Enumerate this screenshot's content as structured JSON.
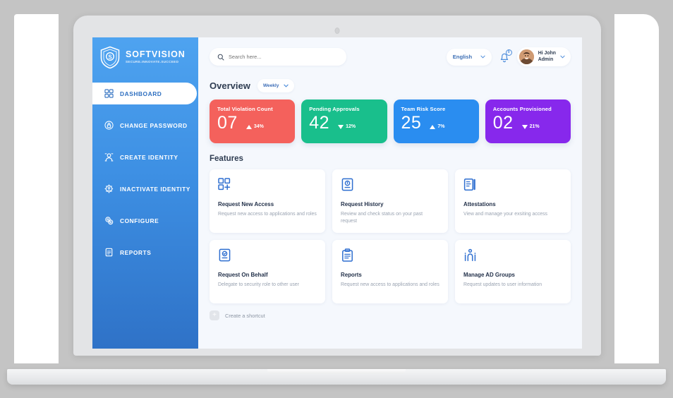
{
  "brand": {
    "name": "SOFTVISION",
    "tagline": "SECURE.INNOVATE.SUCCEED",
    "logo_icon": "shield-s-logo-icon"
  },
  "sidebar": {
    "items": [
      {
        "label": "DASHBOARD",
        "icon": "grid-icon",
        "active": true
      },
      {
        "label": "CHANGE PASSWORD",
        "icon": "lock-circle-icon",
        "active": false
      },
      {
        "label": "CREATE IDENTITY",
        "icon": "user-add-icon",
        "active": false
      },
      {
        "label": "INACTIVATE IDENTITY",
        "icon": "user-gear-icon",
        "active": false
      },
      {
        "label": "CONFIGURE",
        "icon": "gears-icon",
        "active": false
      },
      {
        "label": "REPORTS",
        "icon": "document-icon",
        "active": false
      }
    ]
  },
  "topbar": {
    "search": {
      "placeholder": "Search here...",
      "value": "",
      "icon": "search-icon"
    },
    "language": {
      "selected": "English",
      "icon": "chevron-down-icon"
    },
    "notifications": {
      "count": "0",
      "icon": "bell-icon"
    },
    "user": {
      "greeting": "Hi John",
      "role": "Admin",
      "avatar": "user-avatar",
      "icon": "chevron-down-icon"
    }
  },
  "overview": {
    "title": "Overview",
    "period": {
      "label": "Weekly",
      "icon": "chevron-down-icon"
    },
    "cards": [
      {
        "label": "Total Violation Count",
        "value": "07",
        "delta": "34%",
        "direction": "up",
        "color": "#f4615c"
      },
      {
        "label": "Pending Approvals",
        "value": "42",
        "delta": "12%",
        "direction": "down",
        "color": "#19bf8c"
      },
      {
        "label": "Team Risk Score",
        "value": "25",
        "delta": "7%",
        "direction": "up",
        "color": "#2a8df0"
      },
      {
        "label": "Accounts Provisioned",
        "value": "02",
        "delta": "21%",
        "direction": "down",
        "color": "#8728ec"
      }
    ]
  },
  "features": {
    "title": "Features",
    "cards": [
      {
        "title": "Request New Access",
        "desc": "Request new access to applications and roles",
        "icon": "grid-plus-icon"
      },
      {
        "title": "Request History",
        "desc": "Review and check status on your past request",
        "icon": "history-badge-icon"
      },
      {
        "title": "Attestations",
        "desc": "View and manage your exsiting access",
        "icon": "document-list-icon"
      },
      {
        "title": "Request On Behalf",
        "desc": "Delegate to security role to other user",
        "icon": "badge-check-icon"
      },
      {
        "title": "Reports",
        "desc": "Request new access to applications and roles",
        "icon": "clipboard-icon"
      },
      {
        "title": "Manage AD Groups",
        "desc": "Request updates to user information",
        "icon": "people-group-icon"
      }
    ]
  },
  "shortcut": {
    "label": "Create a shortcut",
    "icon": "plus-icon"
  }
}
